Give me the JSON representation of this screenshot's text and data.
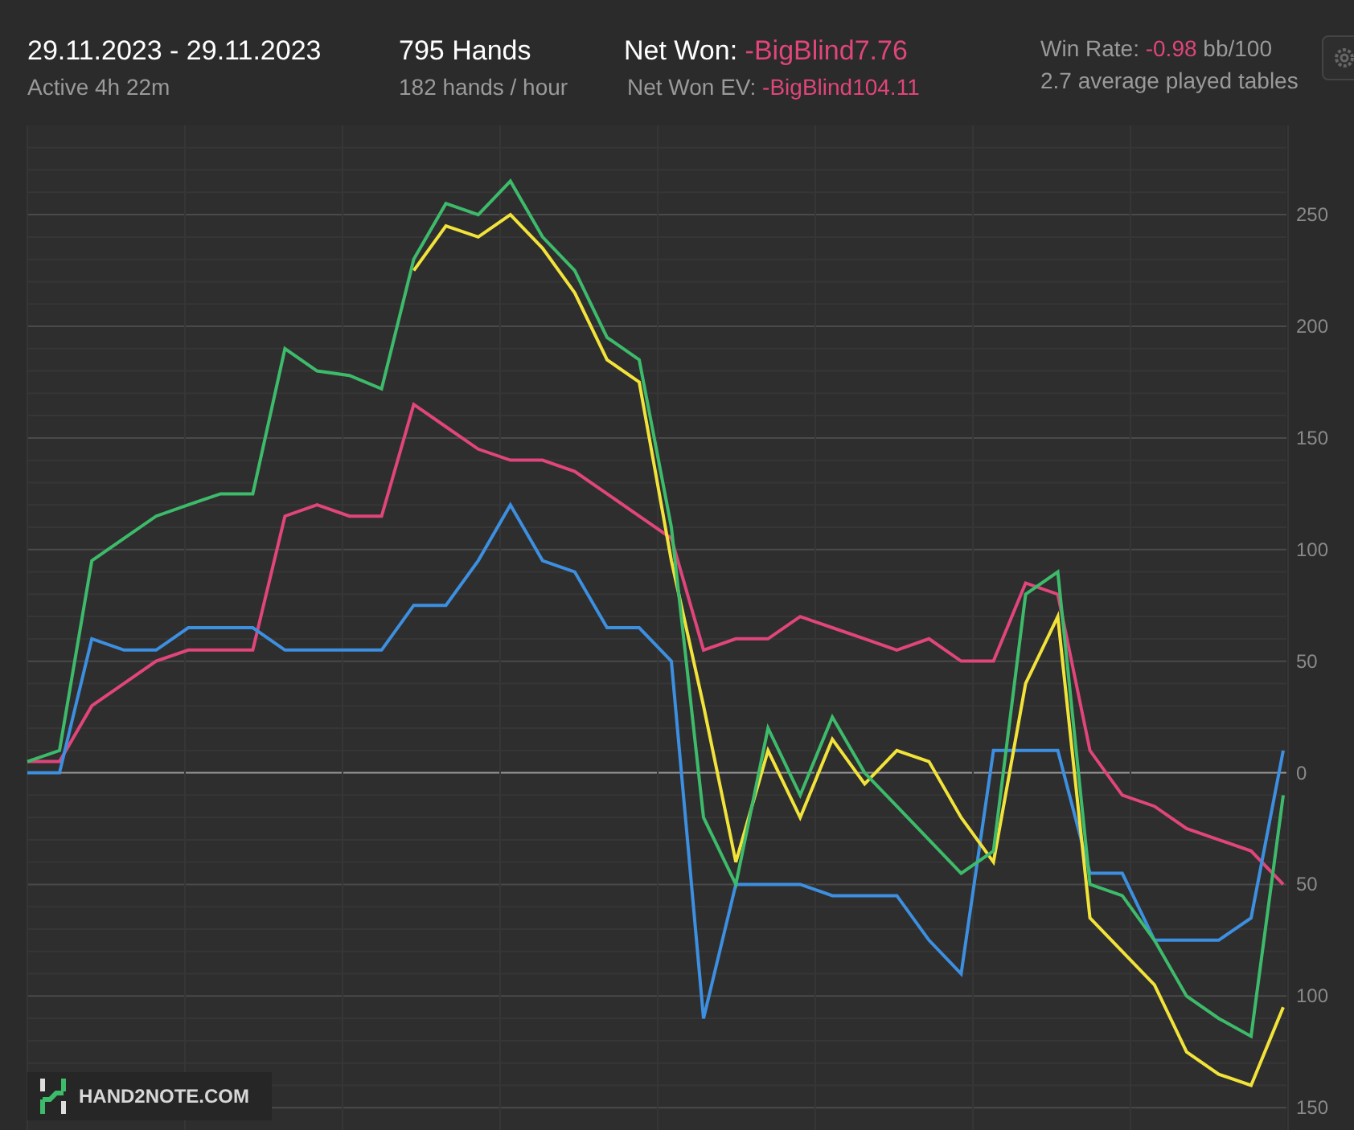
{
  "header": {
    "date_range": "29.11.2023 - 29.11.2023",
    "active": "Active 4h 22m",
    "hands": "795 Hands",
    "hands_rate": "182 hands / hour",
    "net_won_label": "Net Won:",
    "net_won_value": "-BigBlind7.76",
    "net_won_ev_label": "Net Won  EV:",
    "net_won_ev_value": "-BigBlind104.11",
    "win_rate_label": "Win Rate:",
    "win_rate_value": "-0.98",
    "win_rate_unit": "bb/100",
    "tables": "2.7 average played tables"
  },
  "logo": {
    "text": "HAND2NOTE.COM"
  },
  "chart": {
    "chart_data": {
      "type": "line",
      "grid": true,
      "ylim": [
        -160,
        290
      ],
      "yticks": [
        {
          "value": 250,
          "label": "250"
        },
        {
          "value": 200,
          "label": "200"
        },
        {
          "value": 150,
          "label": "150"
        },
        {
          "value": 100,
          "label": "100"
        },
        {
          "value": 50,
          "label": "50"
        },
        {
          "value": 0,
          "label": "0"
        },
        {
          "value": -50,
          "label": "50"
        },
        {
          "value": -100,
          "label": "100"
        },
        {
          "value": -150,
          "label": "150"
        }
      ],
      "series": [
        {
          "color": "#e0457b",
          "values": [
            5,
            5,
            30,
            40,
            50,
            55,
            55,
            55,
            115,
            120,
            115,
            115,
            165,
            155,
            145,
            140,
            140,
            135,
            125,
            115,
            105,
            55,
            60,
            60,
            70,
            65,
            60,
            55,
            60,
            50,
            50,
            85,
            80,
            10,
            -10,
            -15,
            -25,
            -30,
            -35,
            -50
          ]
        },
        {
          "color": "#3d8fe0",
          "values": [
            0,
            0,
            60,
            55,
            55,
            65,
            65,
            65,
            55,
            55,
            55,
            55,
            75,
            75,
            95,
            120,
            95,
            90,
            65,
            65,
            50,
            -110,
            -50,
            -50,
            -50,
            -55,
            -55,
            -55,
            -75,
            -90,
            10,
            10,
            10,
            -45,
            -45,
            -75,
            -75,
            -75,
            -65,
            10
          ]
        },
        {
          "color": "#f2e33a",
          "values": [
            null,
            null,
            null,
            null,
            null,
            null,
            null,
            null,
            null,
            null,
            null,
            null,
            225,
            245,
            240,
            250,
            235,
            215,
            185,
            175,
            95,
            30,
            -40,
            10,
            -20,
            15,
            -5,
            10,
            5,
            -20,
            -40,
            40,
            70,
            -65,
            -80,
            -95,
            -125,
            -135,
            -140,
            -105
          ]
        },
        {
          "color": "#3dbb6b",
          "values": [
            5,
            10,
            95,
            105,
            115,
            120,
            125,
            125,
            190,
            180,
            178,
            172,
            230,
            255,
            250,
            265,
            240,
            225,
            195,
            185,
            110,
            -20,
            -50,
            20,
            -10,
            25,
            0,
            -15,
            -30,
            -45,
            -35,
            80,
            90,
            -50,
            -55,
            -75,
            -100,
            -110,
            -118,
            -10
          ]
        }
      ]
    }
  }
}
